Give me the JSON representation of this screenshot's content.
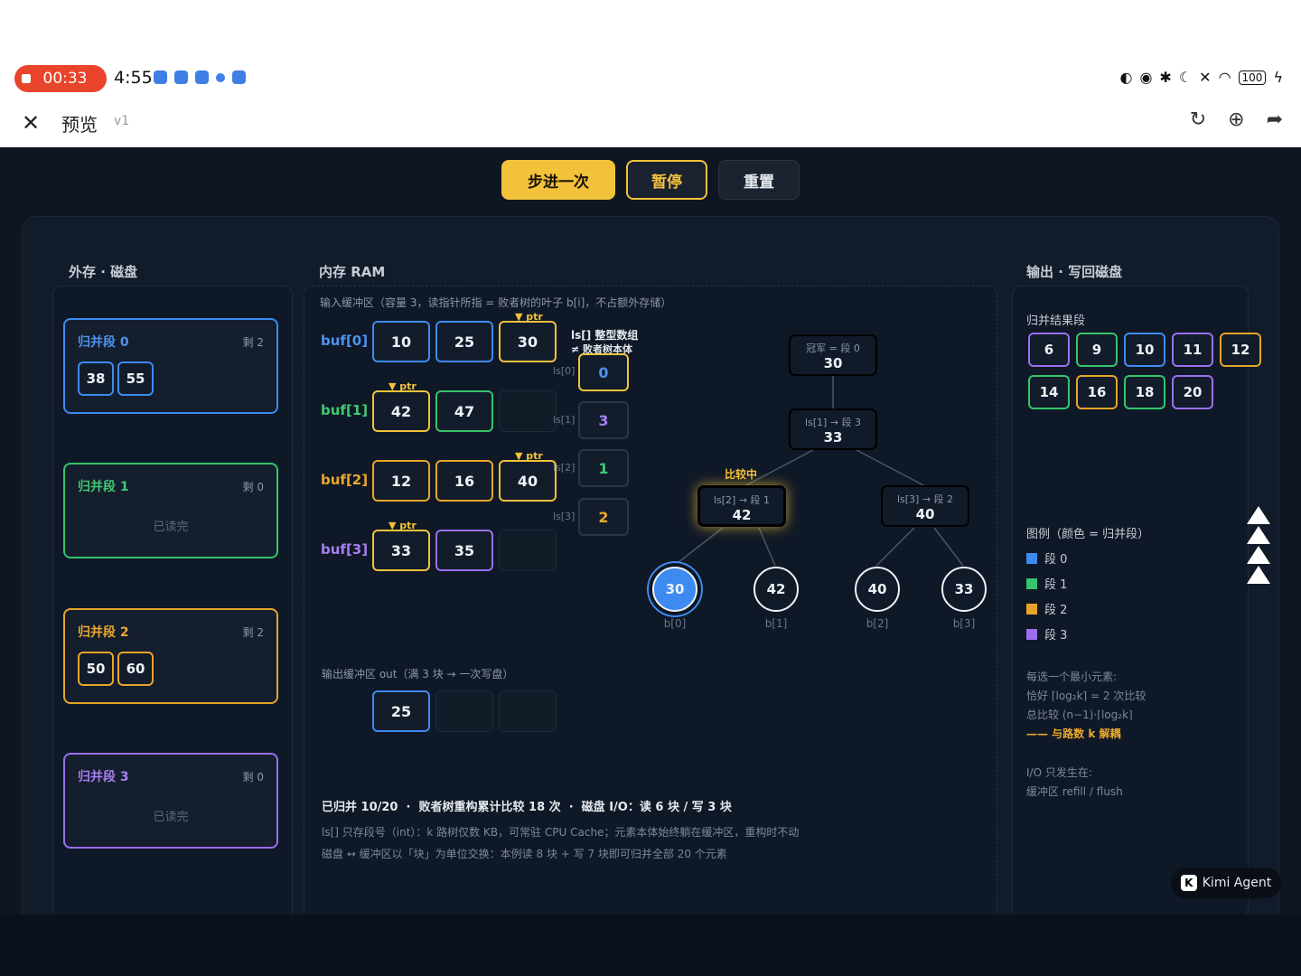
{
  "status": {
    "rec_time": "00:33",
    "clock": "4:55",
    "battery": "100"
  },
  "app": {
    "title": "预览",
    "version": "v1"
  },
  "controls": {
    "step": "步进一次",
    "pause": "暂停",
    "reset": "重置"
  },
  "disk": {
    "title": "外存 · 磁盘",
    "segments": [
      {
        "name": "归并段 0",
        "remain": "剩 2",
        "values": [
          "38",
          "55"
        ],
        "empty": ""
      },
      {
        "name": "归并段 1",
        "remain": "剩 0",
        "values": [],
        "empty": "已读完"
      },
      {
        "name": "归并段 2",
        "remain": "剩 2",
        "values": [
          "50",
          "60"
        ],
        "empty": ""
      },
      {
        "name": "归并段 3",
        "remain": "剩 0",
        "values": [],
        "empty": "已读完"
      }
    ]
  },
  "ram": {
    "title": "内存 RAM",
    "input_note": "输入缓冲区（容量 3，读指针所指 = 败者树的叶子 b[i]，不占额外存储）",
    "ptr": "▼ ptr",
    "buffers": [
      {
        "label": "buf[0]",
        "values": [
          "10",
          "25",
          "30"
        ]
      },
      {
        "label": "buf[1]",
        "values": [
          "42",
          "47"
        ]
      },
      {
        "label": "buf[2]",
        "values": [
          "12",
          "16",
          "40"
        ]
      },
      {
        "label": "buf[3]",
        "values": [
          "33",
          "35"
        ]
      }
    ],
    "ls_title": "ls[] 整型数组",
    "ls_subtitle": "≠ 败者树本体",
    "ls": [
      {
        "label": "ls[0]",
        "value": "0"
      },
      {
        "label": "ls[1]",
        "value": "3"
      },
      {
        "label": "ls[2]",
        "value": "1"
      },
      {
        "label": "ls[3]",
        "value": "2"
      }
    ],
    "output_note": "输出缓冲区 out（满 3 块 → 一次写盘）",
    "output_values": [
      "25"
    ]
  },
  "tree": {
    "champion": {
      "sub": "冠军 = 段 0",
      "val": "30"
    },
    "ls1": {
      "sub": "ls[1] → 段 3",
      "val": "33"
    },
    "comparing": "比较中",
    "ls2": {
      "sub": "ls[2] → 段 1",
      "val": "42"
    },
    "ls3": {
      "sub": "ls[3] → 段 2",
      "val": "40"
    },
    "leaves": [
      {
        "val": "30",
        "label": "b[0]"
      },
      {
        "val": "42",
        "label": "b[1]"
      },
      {
        "val": "40",
        "label": "b[2]"
      },
      {
        "val": "33",
        "label": "b[3]"
      }
    ]
  },
  "stats": {
    "line1": "已归并 10/20  ·  败者树重构累计比较 18 次  ·  磁盘 I/O：读 6 块 / 写 3 块",
    "line2": "ls[] 只存段号（int）：k 路树仅数 KB，可常驻 CPU Cache；元素本体始终躺在缓冲区，重构时不动",
    "line3": "磁盘 ↔ 缓冲区以「块」为单位交换：本例读 8 块 + 写 7 块即可归并全部 20 个元素"
  },
  "output": {
    "title": "输出 · 写回磁盘",
    "result_title": "归并结果段",
    "results": [
      {
        "v": "6",
        "c": "purple"
      },
      {
        "v": "9",
        "c": "green"
      },
      {
        "v": "10",
        "c": "blue"
      },
      {
        "v": "11",
        "c": "purple"
      },
      {
        "v": "12",
        "c": "orange"
      },
      {
        "v": "14",
        "c": "green"
      },
      {
        "v": "16",
        "c": "orange"
      },
      {
        "v": "18",
        "c": "green"
      },
      {
        "v": "20",
        "c": "purple"
      }
    ],
    "legend_title": "图例（颜色 = 归并段）",
    "legend": [
      "段 0",
      "段 1",
      "段 2",
      "段 3"
    ],
    "note1": "每选一个最小元素:",
    "note2": "恰好 ⌈log₂k⌉ = 2 次比较",
    "note3": "总比较 (n−1)·⌈log₂k⌉",
    "note4": "—— 与路数 k 解耦",
    "io1": "I/O 只发生在:",
    "io2": "缓冲区 refill / flush"
  },
  "kimi": "Kimi Agent",
  "colors": {
    "seg0": "#3d8bf0",
    "seg1": "#35c46b",
    "seg2": "#e6a52a",
    "seg3": "#9b6ff0",
    "accent": "#f3c23b"
  }
}
